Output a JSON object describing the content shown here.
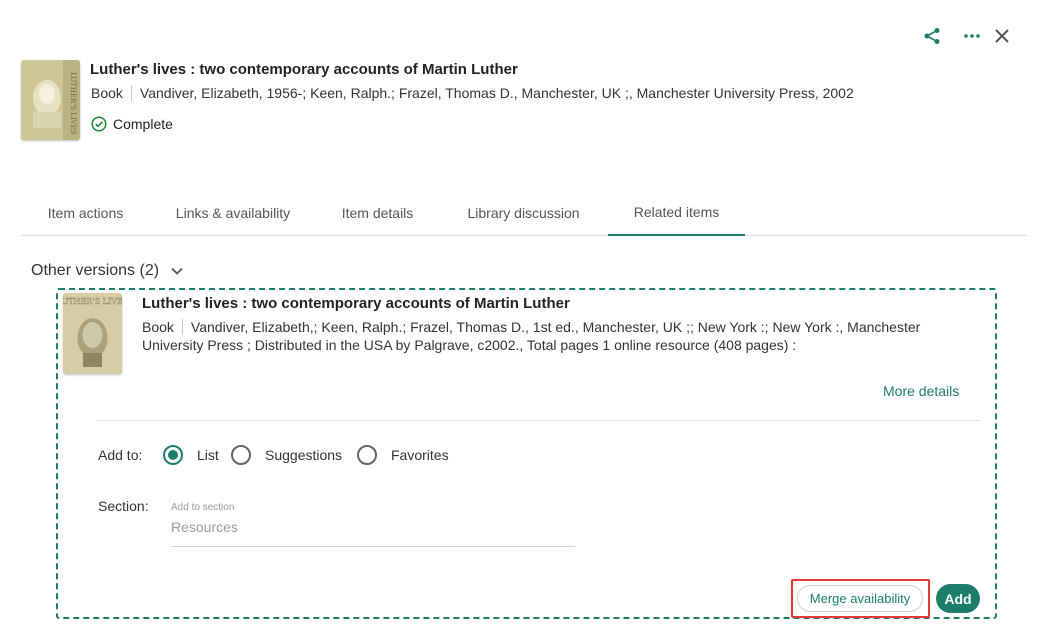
{
  "toolbar": {
    "share_icon": "share-icon",
    "more_icon": "more-horizontal-icon",
    "close_icon": "close-icon"
  },
  "record": {
    "title": "Luther's lives : two contemporary accounts of Martin Luther",
    "type": "Book",
    "details": "Vandiver, Elizabeth, 1956-; Keen, Ralph.; Frazel, Thomas D., Manchester, UK ;, Manchester University Press, 2002",
    "status": "Complete",
    "cover_text": "LUTHER'S LIVES"
  },
  "tabs": [
    {
      "label": "Item actions"
    },
    {
      "label": "Links & availability"
    },
    {
      "label": "Item details"
    },
    {
      "label": "Library discussion"
    },
    {
      "label": "Related items"
    }
  ],
  "other_versions": {
    "label": "Other versions (2)",
    "version": {
      "title": "Luther's lives : two contemporary accounts of Martin Luther",
      "type": "Book",
      "details_line1": "Vandiver, Elizabeth,; Keen, Ralph.; Frazel, Thomas D., 1st ed., Manchester, UK ;; New York :; New York :, Manchester",
      "details_line2": "University Press ; Distributed in the USA by Palgrave, c2002., Total pages 1 online resource (408 pages) :",
      "cover_text": "LUTHER'S LIVES",
      "more_details": "More details"
    },
    "add_to": {
      "label": "Add to:",
      "options": [
        {
          "label": "List",
          "checked": true
        },
        {
          "label": "Suggestions",
          "checked": false
        },
        {
          "label": "Favorites",
          "checked": false
        }
      ]
    },
    "section": {
      "label": "Section:",
      "floating_label": "Add to section",
      "placeholder": "Resources"
    },
    "buttons": {
      "merge": "Merge availability",
      "add": "Add"
    }
  },
  "colors": {
    "accent": "#1e7d6a",
    "highlight": "#e53935"
  }
}
